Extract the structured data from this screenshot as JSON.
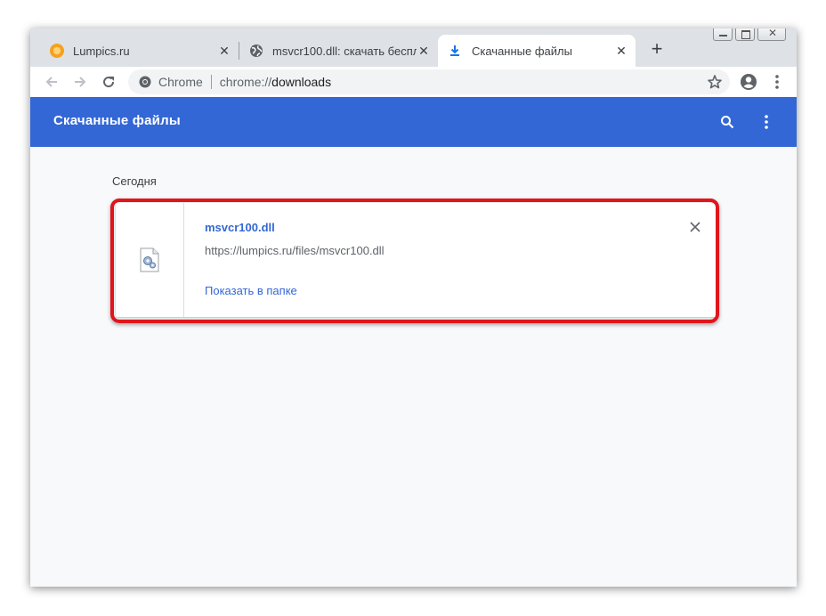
{
  "tabs": [
    {
      "title": "Lumpics.ru",
      "icon": "orange-icon",
      "active": false
    },
    {
      "title": "msvcr100.dll: скачать беспла",
      "icon": "globe-icon",
      "active": false
    },
    {
      "title": "Скачанные файлы",
      "icon": "download-icon",
      "active": true
    }
  ],
  "toolbar": {
    "site_label": "Chrome",
    "url_scheme": "chrome://",
    "url_path": "downloads"
  },
  "header": {
    "title": "Скачанные файлы"
  },
  "downloads": {
    "date_group": "Сегодня",
    "items": [
      {
        "file_name": "msvcr100.dll",
        "url": "https://lumpics.ru/files/msvcr100.dll",
        "action_label": "Показать в папке",
        "icon": "dll-file-icon"
      }
    ]
  },
  "colors": {
    "header_bg": "#3367d6",
    "link": "#3367d6",
    "highlight": "#e0161c"
  }
}
